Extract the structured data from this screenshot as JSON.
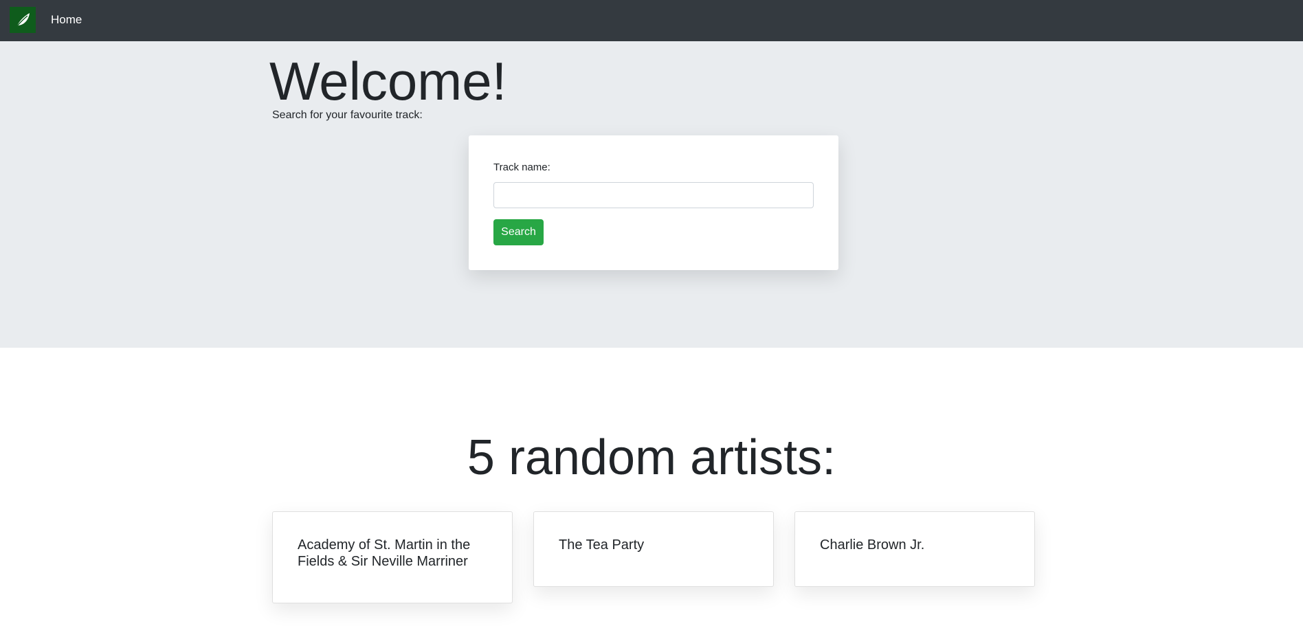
{
  "nav": {
    "brand_icon": "leaf-icon",
    "home_label": "Home",
    "colors": {
      "background": "#343a40",
      "brand": "#0f5c1c"
    }
  },
  "jumbotron": {
    "title": "Welcome!",
    "subtitle": "Search for your favourite track:",
    "form": {
      "track_label": "Track name:",
      "track_value": "",
      "search_label": "Search"
    },
    "colors": {
      "background": "#e9ecef",
      "button": "#28a745"
    }
  },
  "artists": {
    "heading": "5 random artists:",
    "items": [
      {
        "name": "Academy of St. Martin in the Fields & Sir Neville Marriner"
      },
      {
        "name": "The Tea Party"
      },
      {
        "name": "Charlie Brown Jr."
      }
    ]
  }
}
